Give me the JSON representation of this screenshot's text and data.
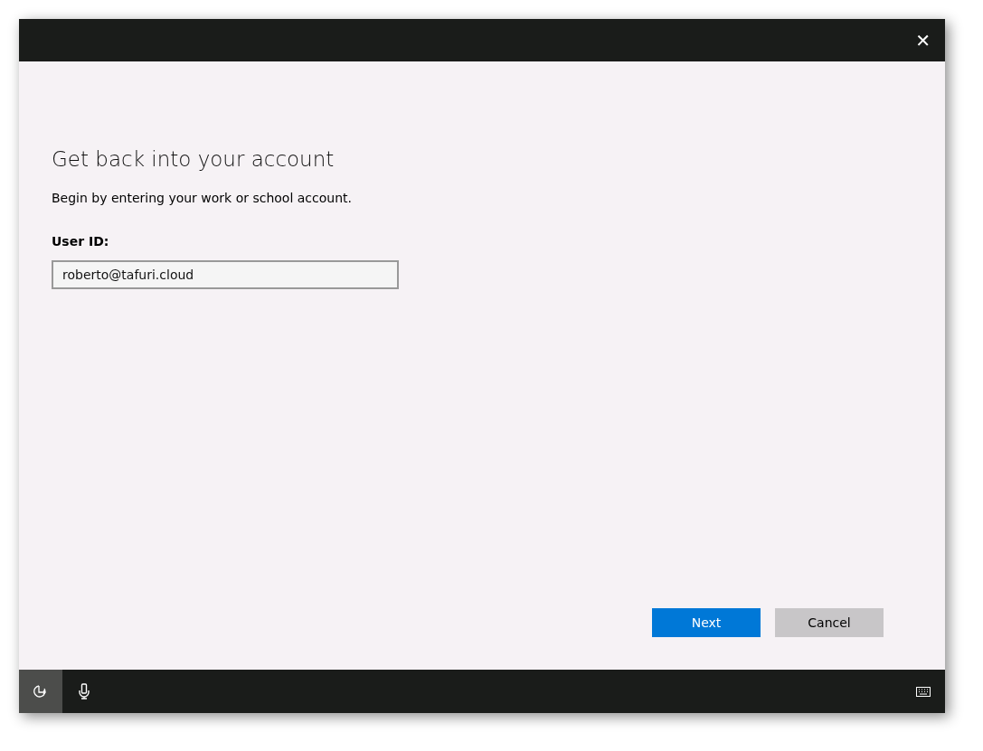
{
  "window": {
    "close_glyph": "✕"
  },
  "heading": "Get back into your account",
  "instructions": "Begin by entering your work or school account.",
  "user_id": {
    "label": "User ID:",
    "value": "roberto@tafuri.cloud"
  },
  "buttons": [
    {
      "label": "Next",
      "kind": "primary"
    },
    {
      "label": "Cancel",
      "kind": "secondary"
    }
  ],
  "bottom_bar": {
    "items": [
      {
        "kind": "ease-of-access",
        "selected": true
      },
      {
        "kind": "microphone",
        "selected": false
      }
    ],
    "right_items": [
      {
        "kind": "keyboard",
        "selected": false
      }
    ]
  }
}
